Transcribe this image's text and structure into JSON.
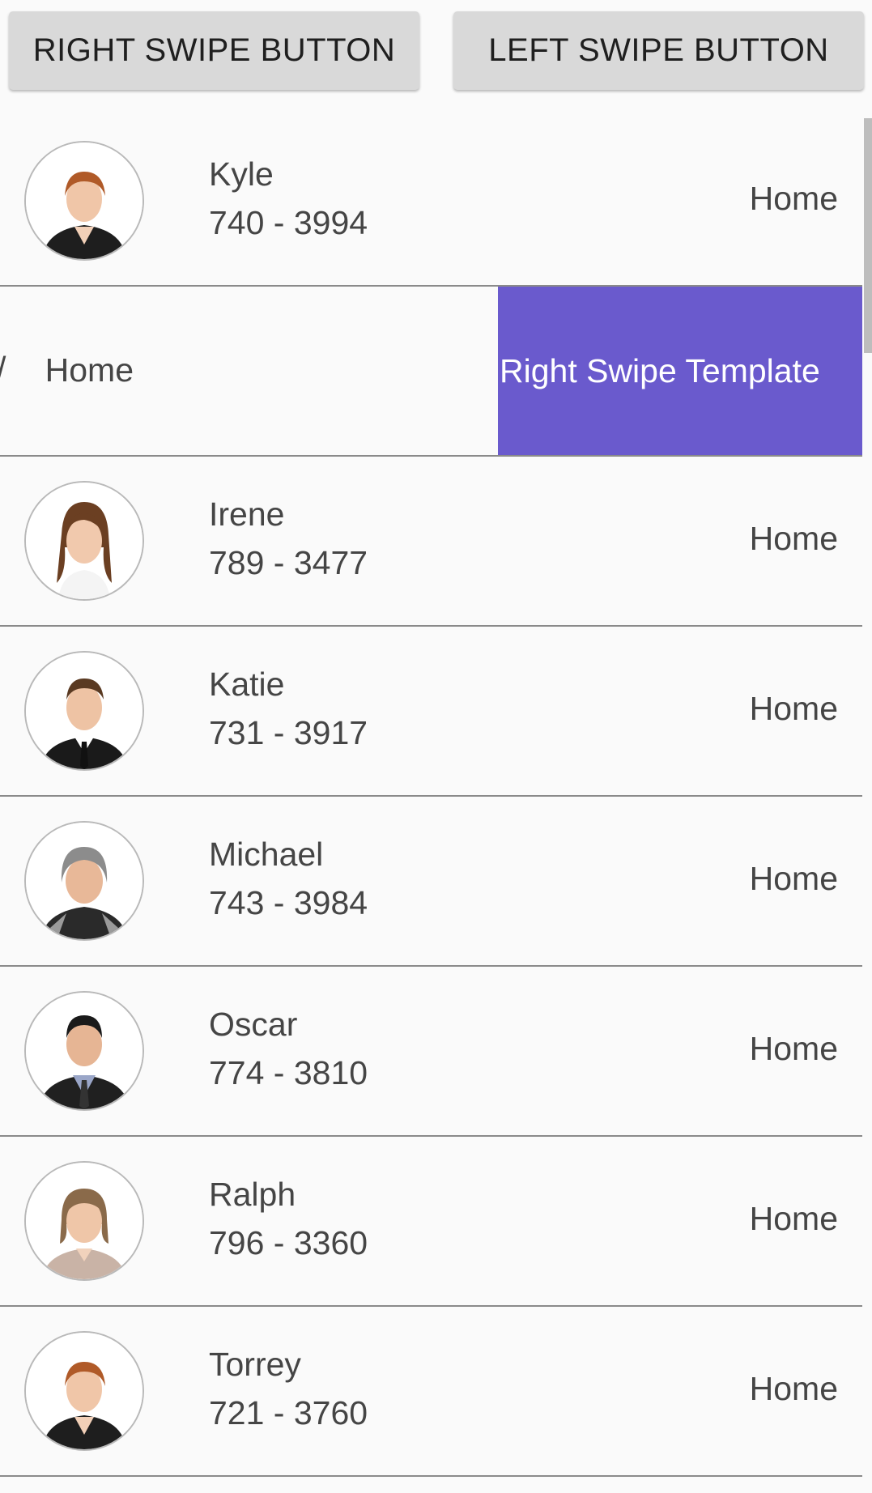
{
  "toolbar": {
    "right_swipe_label": "RIGHT SWIPE BUTTON",
    "left_swipe_label": "LEFT SWIPE BUTTON"
  },
  "contacts": [
    {
      "name": "Kyle",
      "phone": "740 - 3994",
      "type": "Home",
      "avatar": "businesswoman-red-hair"
    },
    {
      "name": "",
      "phone": "",
      "type": "Home",
      "avatar": "",
      "swipe_template": "Right Swipe Template",
      "partial_glyph": "/"
    },
    {
      "name": "Irene",
      "phone": "789 - 3477",
      "type": "Home",
      "avatar": "woman-long-brown-hair"
    },
    {
      "name": "Katie",
      "phone": "731 - 3917",
      "type": "Home",
      "avatar": "man-suit-tie"
    },
    {
      "name": "Michael",
      "phone": "743 - 3984",
      "type": "Home",
      "avatar": "older-woman-gray-hair"
    },
    {
      "name": "Oscar",
      "phone": "774 - 3810",
      "type": "Home",
      "avatar": "young-man-dark-suit"
    },
    {
      "name": "Ralph",
      "phone": "796 - 3360",
      "type": "Home",
      "avatar": "woman-shoulder-hair"
    },
    {
      "name": "Torrey",
      "phone": "721 - 3760",
      "type": "Home",
      "avatar": "businesswoman-red-hair"
    }
  ],
  "colors": {
    "swipe_template_bg": "#6a5acd",
    "button_bg": "#d9d9d9",
    "divider": "#8a8a8a"
  }
}
